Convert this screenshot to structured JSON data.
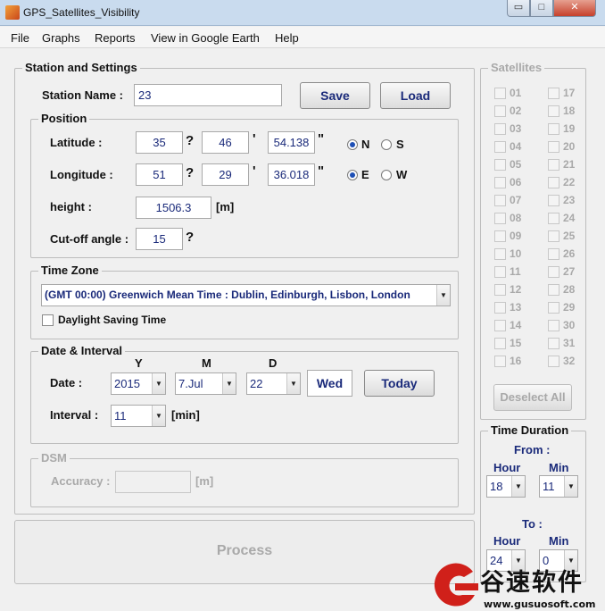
{
  "window": {
    "title": "GPS_Satellites_Visibility",
    "min_glyph": "▭",
    "max_glyph": "□",
    "close_glyph": "✕"
  },
  "menu": [
    "File",
    "Graphs",
    "Reports",
    "View in Google Earth",
    "Help"
  ],
  "station": {
    "legend": "Station and Settings",
    "name_label": "Station Name :",
    "name_value": "23",
    "save": "Save",
    "load": "Load"
  },
  "position": {
    "legend": "Position",
    "latitude_label": "Latitude :",
    "lat_deg": "35",
    "lat_min": "46",
    "lat_sec": "54.138",
    "longitude_label": "Longitude :",
    "lon_deg": "51",
    "lon_min": "29",
    "lon_sec": "36.018",
    "deg_symbol": "?",
    "min_symbol": "'",
    "sec_symbol": "\"",
    "north": "N",
    "south": "S",
    "east": "E",
    "west": "W",
    "height_label": "height :",
    "height_value": "1506.3",
    "height_unit": "[m]",
    "cutoff_label": "Cut-off angle :",
    "cutoff_value": "15",
    "cutoff_symbol": "?"
  },
  "timezone": {
    "legend": "Time Zone",
    "selected": "(GMT 00:00) Greenwich Mean Time : Dublin, Edinburgh, Lisbon, London",
    "dst_label": "Daylight Saving Time"
  },
  "date": {
    "legend": "Date & Interval",
    "y_head": "Y",
    "m_head": "M",
    "d_head": "D",
    "date_label": "Date :",
    "year": "2015",
    "month": "7.Jul",
    "day": "22",
    "weekday": "Wed",
    "today": "Today",
    "interval_label": "Interval :",
    "interval": "11",
    "interval_unit": "[min]"
  },
  "dsm": {
    "legend": "DSM",
    "accuracy_label": "Accuracy :",
    "accuracy_value": "",
    "unit": "[m]"
  },
  "process": "Process",
  "satellites": {
    "legend": "Satellites",
    "left": [
      "01",
      "02",
      "03",
      "04",
      "05",
      "06",
      "07",
      "08",
      "09",
      "10",
      "11",
      "12",
      "13",
      "14",
      "15",
      "16"
    ],
    "right": [
      "17",
      "18",
      "19",
      "20",
      "21",
      "22",
      "23",
      "24",
      "25",
      "26",
      "27",
      "28",
      "29",
      "30",
      "31",
      "32"
    ],
    "deselect": "Deselect All"
  },
  "duration": {
    "legend": "Time Duration",
    "from": "From :",
    "to": "To :",
    "hour": "Hour",
    "min": "Min",
    "from_hour": "18",
    "from_min": "11",
    "to_hour": "24",
    "to_min": "0"
  },
  "watermark": {
    "text": "谷速软件",
    "url": "www.gusuosoft.com"
  },
  "colors": {
    "accent_text": "#1a2a7a",
    "disabled": "#a9a9a9",
    "logo_red": "#d0201a"
  }
}
